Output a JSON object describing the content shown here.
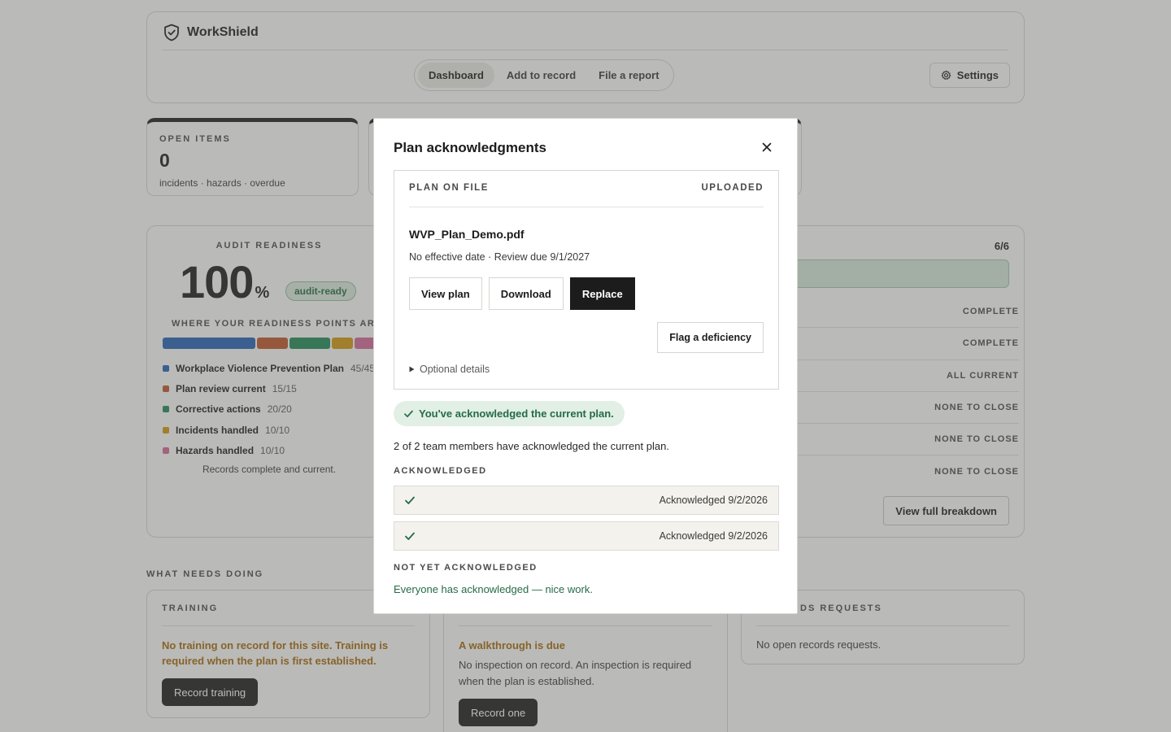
{
  "header": {
    "brand": "WorkShield",
    "nav": [
      "Dashboard",
      "Add to record",
      "File a report"
    ],
    "active_tab": "Dashboard",
    "settings_label": "Settings"
  },
  "stats": {
    "open_items": {
      "label": "OPEN ITEMS",
      "value": "0",
      "sub": "incidents · hazards · overdue"
    }
  },
  "audit": {
    "title": "AUDIT READINESS",
    "score": "100",
    "score_unit": "%",
    "badge": "audit-ready",
    "points_title": "WHERE YOUR READINESS POINTS ARE",
    "items": [
      {
        "label": "Workplace Violence Prevention Plan",
        "value": "45/45",
        "color": "#2563b8"
      },
      {
        "label": "Plan review current",
        "value": "15/15",
        "color": "#c2562b"
      },
      {
        "label": "Corrective actions",
        "value": "20/20",
        "color": "#1f8a5b"
      },
      {
        "label": "Incidents handled",
        "value": "10/10",
        "color": "#d49a0e"
      },
      {
        "label": "Hazards handled",
        "value": "10/10",
        "color": "#d46a9a"
      }
    ],
    "footer": "Records complete and current."
  },
  "checklist": {
    "count": "6/6",
    "statuses": [
      "COMPLETE",
      "COMPLETE",
      "ALL CURRENT",
      "NONE TO CLOSE",
      "NONE TO CLOSE",
      "NONE TO CLOSE"
    ],
    "breakdown_button": "View full breakdown"
  },
  "needs": {
    "heading": "WHAT NEEDS DOING",
    "training": {
      "label": "TRAINING",
      "warning": "No training on record for this site. Training is required when the plan is first established.",
      "button": "Record training"
    },
    "walkthrough": {
      "warning": "A walkthrough is due",
      "text": "No inspection on record. An inspection is required when the plan is established.",
      "button": "Record one"
    },
    "records": {
      "label_partial": "DS REQUESTS",
      "text": "No open records requests."
    }
  },
  "modal": {
    "title": "Plan acknowledgments",
    "plan_box": {
      "heading": "PLAN ON FILE",
      "status": "UPLOADED",
      "file_name": "WVP_Plan_Demo.pdf",
      "meta": "No effective date · Review due 9/1/2027",
      "view_button": "View plan",
      "download_button": "Download",
      "replace_button": "Replace",
      "flag_button": "Flag a deficiency",
      "optional_details": "Optional details"
    },
    "ack_status": "You've acknowledged the current plan.",
    "ack_count": "2 of 2 team members have acknowledged the current plan.",
    "acknowledged_label": "ACKNOWLEDGED",
    "acknowledged": [
      {
        "date": "Acknowledged 9/2/2026"
      },
      {
        "date": "Acknowledged 9/2/2026"
      }
    ],
    "not_yet_label": "NOT YET ACKNOWLEDGED",
    "everyone_text": "Everyone has acknowledged — nice work."
  }
}
